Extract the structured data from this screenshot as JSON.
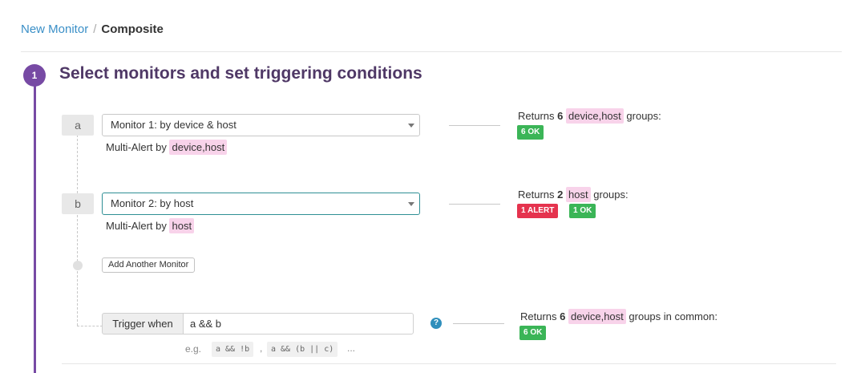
{
  "breadcrumb": {
    "parent": "New Monitor",
    "separator": "/",
    "current": "Composite"
  },
  "step": {
    "number": "1",
    "title": "Select monitors and set triggering conditions"
  },
  "monitors": [
    {
      "letter": "a",
      "selected": "Monitor 1: by device & host",
      "multi_alert_prefix": "Multi-Alert by",
      "group_tag": "device,host",
      "result": {
        "prefix": "Returns",
        "count": "6",
        "tag": "device,host",
        "suffix": "groups:"
      },
      "badges": [
        {
          "label": "6 OK",
          "status": "ok"
        }
      ]
    },
    {
      "letter": "b",
      "selected": "Monitor 2: by host",
      "multi_alert_prefix": "Multi-Alert by",
      "group_tag": "host",
      "result": {
        "prefix": "Returns",
        "count": "2",
        "tag": "host",
        "suffix": "groups:"
      },
      "badges": [
        {
          "label": "1 ALERT",
          "status": "alert"
        },
        {
          "label": "1 OK",
          "status": "ok"
        }
      ]
    }
  ],
  "add_monitor_label": "Add Another Monitor",
  "trigger": {
    "label": "Trigger when",
    "value": "a && b",
    "help_icon": "question-circle-icon",
    "examples_prefix": "e.g.",
    "examples": [
      "a && !b",
      "a && (b || c)"
    ],
    "examples_separator": ",",
    "examples_ellipsis": "...",
    "result": {
      "prefix": "Returns",
      "count": "6",
      "tag": "device,host",
      "suffix": "groups in common:"
    },
    "badges": [
      {
        "label": "6 OK",
        "status": "ok"
      }
    ]
  },
  "colors": {
    "accent": "#774aa4",
    "ok": "#3bb557",
    "alert": "#e5334e",
    "tag": "#f8d3ea",
    "link": "#3a8fc7"
  }
}
